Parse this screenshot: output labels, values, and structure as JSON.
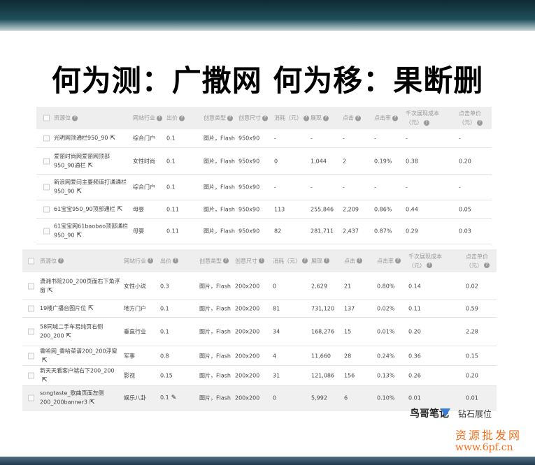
{
  "title": "何为测：广撒网  何为移：果断删",
  "headers1": [
    "资源位",
    "网站行业",
    "出价",
    "创意类型",
    "创意尺寸",
    "消耗（元）",
    "展现",
    "点击",
    "点击率",
    "千次展现成本（元）",
    "点击单价（元）"
  ],
  "headers2": [
    "资源位",
    "网站行业",
    "出价",
    "创意类型",
    "创意尺寸",
    "消耗（元）",
    "展现",
    "点击",
    "点击率",
    "千次展现成本（元）",
    "点击单价（元）"
  ],
  "table1": [
    [
      "光明网顶通栏950_90",
      "综合门户",
      "0.1",
      "图片，Flash",
      "950x90",
      "-",
      "-",
      "-",
      "-",
      "-",
      "-"
    ],
    [
      "爱丽时尚网爱丽网顶部950_90通栏",
      "女性时尚",
      "0.1",
      "图片，Flash",
      "950x90",
      "0",
      "1,044",
      "2",
      "0.19%",
      "0.38",
      "0.20"
    ],
    [
      "新浪网爱问主要频道打通通栏950_90",
      "综合门户",
      "0.1",
      "图片，Flash",
      "950x90",
      "-",
      "-",
      "-",
      "-",
      "-",
      "-"
    ],
    [
      "61宝宝950_90顶部通栏",
      "母婴",
      "0.11",
      "图片，Flash",
      "950x90",
      "113",
      "255,846",
      "2,209",
      "0.86%",
      "0.44",
      "0.05"
    ],
    [
      "61宝宝网61baobao顶部通栏950_90",
      "母婴",
      "0.11",
      "图片，Flash",
      "950x90",
      "82",
      "281,711",
      "2,437",
      "0.87%",
      "0.29",
      "0.03"
    ]
  ],
  "table2": [
    [
      "潇湘书院200_200页面右下角浮窗",
      "女性小说",
      "0.3",
      "图片，Flash",
      "200x200",
      "0",
      "2,629",
      "21",
      "0.80%",
      "0.14",
      "0.02"
    ],
    [
      "19楼广播台图片位",
      "地方门户",
      "0.1",
      "图片，Flash",
      "200x200",
      "81",
      "731,120",
      "137",
      "0.02%",
      "0.11",
      "0.59"
    ],
    [
      "58同城二手车易纯页右侧200_200",
      "垂直行业",
      "0.1",
      "图片，Flash",
      "200x200",
      "34",
      "168,276",
      "15",
      "0.01%",
      "0.20",
      "2.28"
    ],
    [
      "香哈网_香哈菜谱200_200浮窗",
      "军事",
      "0.8",
      "图片，Flash",
      "200x200",
      "4",
      "11,660",
      "28",
      "0.24%",
      "0.36",
      "0.15"
    ],
    [
      "新天天看客户端右下200_200",
      "影视",
      "0.15",
      "图片，Flash",
      "200x200",
      "31",
      "121,086",
      "156",
      "0.13%",
      "0.26",
      "0.20"
    ],
    [
      "songtaste_歌曲页面左侧200_200banner3",
      "娱乐八卦",
      "0.1",
      "图片，Flash",
      "200x200",
      "0",
      "5,992",
      "6",
      "0.10%",
      "0.01",
      "0.01"
    ]
  ],
  "footer": {
    "logo_text": "鸟哥笔记",
    "brand": "钻石展位",
    "watermark_line1": "资源批发网",
    "watermark_line2": "www.6pf.cn"
  }
}
